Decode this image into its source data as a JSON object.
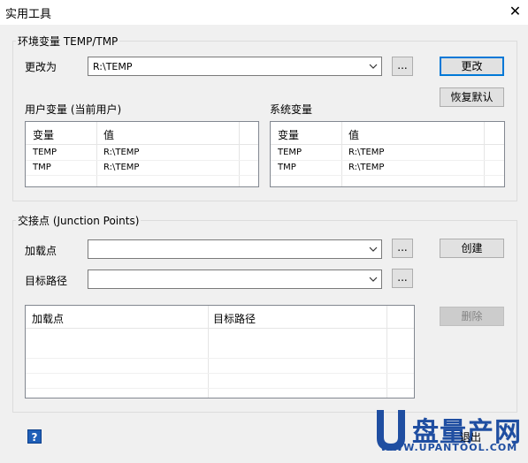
{
  "window": {
    "title": "实用工具",
    "close_glyph": "✕"
  },
  "env_group": {
    "title": "环境变量 TEMP/TMP",
    "change_to_label": "更改为",
    "change_to_value": "R:\\TEMP",
    "browse_label": "...",
    "change_button": "更改",
    "restore_button": "恢复默认",
    "user_vars_title": "用户变量 (当前用户)",
    "system_vars_title": "系统变量",
    "columns": [
      "变量",
      "值"
    ],
    "user_rows": [
      {
        "var": "TEMP",
        "value": "R:\\TEMP"
      },
      {
        "var": "TMP",
        "value": "R:\\TEMP"
      }
    ],
    "system_rows": [
      {
        "var": "TEMP",
        "value": "R:\\TEMP"
      },
      {
        "var": "TMP",
        "value": "R:\\TEMP"
      }
    ]
  },
  "junction_group": {
    "title": "交接点 (Junction Points)",
    "mount_label": "加载点",
    "mount_value": "",
    "target_label": "目标路径",
    "target_value": "",
    "browse_label": "...",
    "create_button": "创建",
    "delete_button": "删除",
    "columns": [
      "加载点",
      "目标路径"
    ]
  },
  "footer": {
    "help_glyph": "?",
    "exit_button": "退出"
  },
  "watermark": {
    "brand": "盘量产网",
    "url": "WWW.UPANTOOL.COM"
  },
  "colors": {
    "accent": "#0078d7",
    "window_bg": "#f0f0f0",
    "watermark_blue": "#1f4ea1"
  }
}
